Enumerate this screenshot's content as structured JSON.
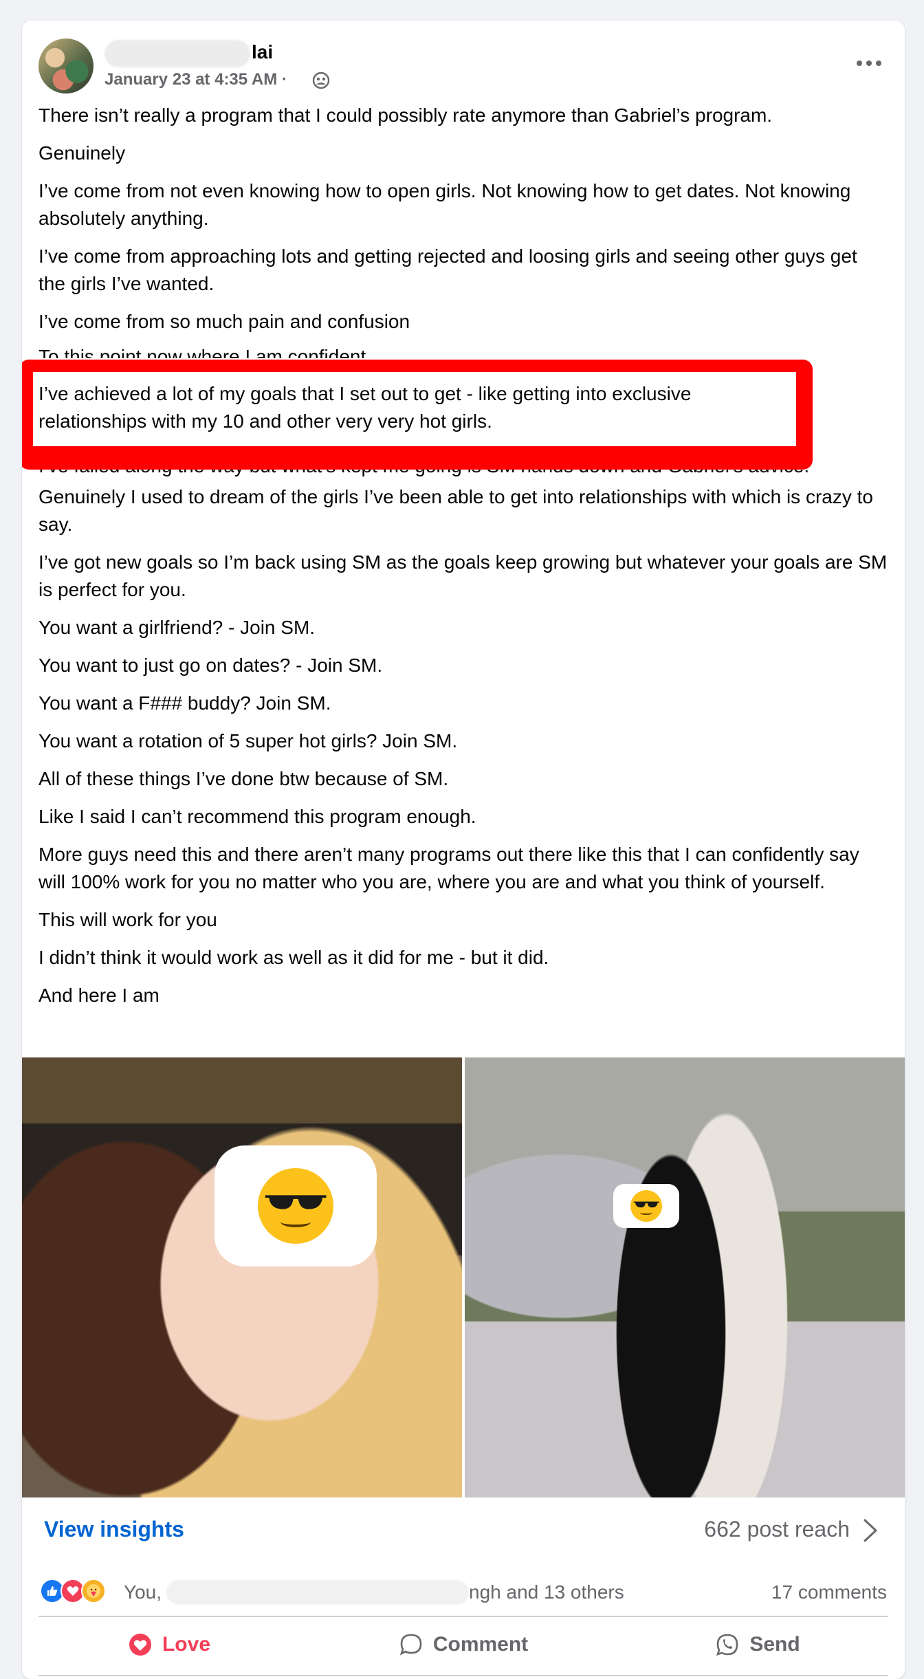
{
  "post": {
    "author_suffix": "lai",
    "timestamp": "January 23 at 4:35 AM ·",
    "paragraphs_before": [
      "There isn’t really a program that I could possibly rate anymore than Gabriel’s program.",
      "Genuinely",
      "I’ve come from not even knowing how to open girls. Not knowing how to get dates. Not knowing absolutely anything.",
      "I’ve come from approaching lots and getting rejected and loosing girls and seeing other guys get the girls I’ve wanted.",
      "I’ve come from so much pain and confusion"
    ],
    "partially_hidden_top": "To this point now where I am confident",
    "highlighted": "I’ve achieved a lot of my goals that I set out to get - like getting into exclusive relationships with my 10 and other very very hot girls.",
    "partially_hidden_bottom": "I’ve failed along the way but what’s kept me going is SM hands down and Gabriel’s advice.",
    "paragraphs_after": [
      "Genuinely I used to dream of the girls I’ve been able to get into relationships with which is crazy to say.",
      "I’ve got new goals so I’m back using SM as the goals keep growing but whatever your goals are SM is perfect for you.",
      "You want a girlfriend? - Join SM.",
      "You want to just go on dates? - Join SM.",
      "You want a F### buddy? Join SM.",
      "You want a rotation of 5 super hot girls? Join SM.",
      "All of these things I’ve done btw because of SM.",
      "Like I said I can’t recommend this program enough.",
      "More guys need this and there aren’t many programs out there like this that I can confidently say will 100% work for you no matter who you are, where you are and what you think of yourself.",
      "This will work for you",
      "I didn’t think it would work as well as it did for me - but it did.",
      "And here I am"
    ]
  },
  "footer": {
    "view_insights": "View insights",
    "post_reach": "662 post reach",
    "reactors_you": "You,",
    "reactors_rest": "ngh and 13 others",
    "comments": "17 comments",
    "actions": {
      "love": "Love",
      "comment": "Comment",
      "send": "Send"
    }
  },
  "colors": {
    "link_blue": "#0064d1",
    "love_red": "#f33e58",
    "highlight_red": "#ff0000",
    "secondary_text": "#65676b"
  }
}
